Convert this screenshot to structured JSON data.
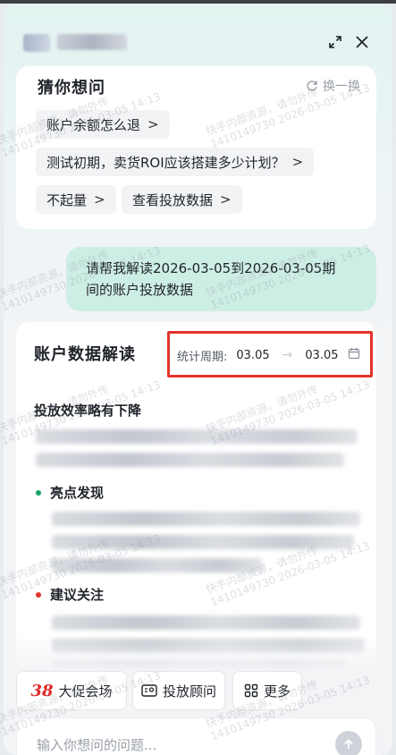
{
  "header": {
    "expand_icon": "expand-arrows-icon",
    "close_icon": "close-x-icon"
  },
  "guess": {
    "title": "猜你想问",
    "refresh_label": "换一换",
    "chips": [
      {
        "label": "账户余额怎么退",
        "chevron": ">"
      },
      {
        "label": "测试初期，卖货ROI应该搭建多少计划？",
        "chevron": ">"
      },
      {
        "label": "不起量",
        "chevron": ">"
      },
      {
        "label": "查看投放数据",
        "chevron": ">"
      }
    ]
  },
  "user_message": {
    "line1": "请帮我解读2026-03-05到2026-03-05期",
    "line2": "间的账户投放数据"
  },
  "analysis": {
    "title": "账户数据解读",
    "period_label": "统计周期:",
    "period_start": "03.05",
    "period_arrow": "→",
    "period_end": "03.05",
    "subtitle": "投放效率略有下降",
    "sections": [
      {
        "label": "亮点发现",
        "dot_color": "#1aa36a"
      },
      {
        "label": "建议关注",
        "dot_color": "#e0362c"
      }
    ]
  },
  "quick_actions": [
    {
      "badge": "38",
      "label": "大促会场",
      "icon": "promo-38-icon"
    },
    {
      "label": "投放顾问",
      "icon": "advisor-card-icon"
    },
    {
      "label": "更多",
      "icon": "grid-more-icon"
    }
  ],
  "input": {
    "placeholder": "输入你想问的问题...",
    "send_icon": "send-arrow-up-icon"
  },
  "watermark": {
    "lines": [
      "快手内部资源，请勿外传",
      "1410149730 2026-03-05 14:13"
    ]
  },
  "colors": {
    "accent_green": "#1aa36a",
    "highlight_red": "#e4342a",
    "bubble_bg": "#cdeee4",
    "promo_red": "#e02828"
  }
}
